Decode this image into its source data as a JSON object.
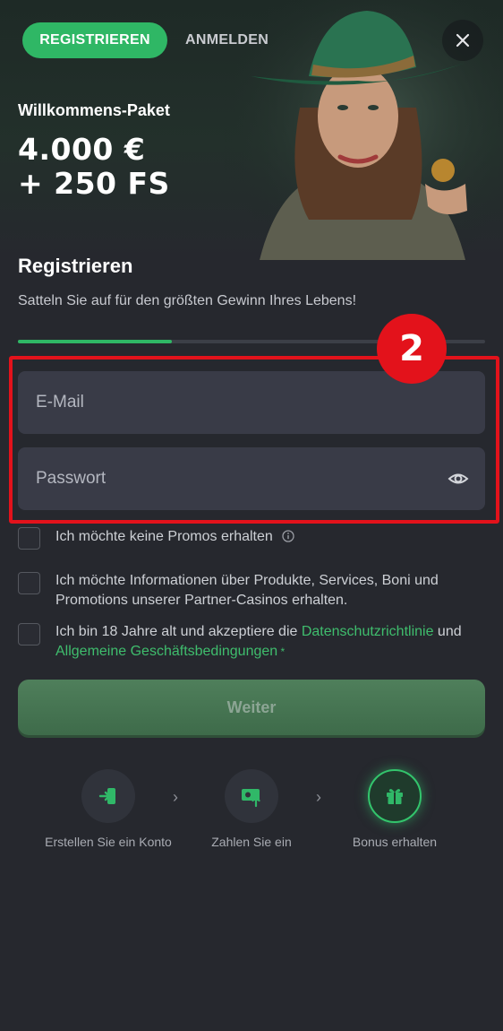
{
  "header": {
    "tab_register": "REGISTRIEREN",
    "tab_login": "ANMELDEN"
  },
  "promo": {
    "label": "Willkommens-Paket",
    "amount_line1": "4.000 €",
    "amount_line2": "+ 250 FS"
  },
  "form": {
    "title": "Registrieren",
    "subtitle": "Satteln Sie auf für den größten Gewinn Ihres Lebens!",
    "progress": 0.33,
    "email_placeholder": "E-Mail",
    "password_placeholder": "Passwort",
    "step_marker": "2",
    "checkboxes": [
      {
        "text": "Ich möchte keine Promos erhalten"
      },
      {
        "text": "Ich möchte Informationen über Produkte, Services, Boni und Promotions unserer Partner-Casinos erhalten."
      },
      {
        "text_before": "Ich bin 18 Jahre alt und akzeptiere die ",
        "link1": "Datenschutzrichtlinie",
        "text_mid": " und ",
        "link2": "Allgemeine Geschäftsbedingungen",
        "required_mark": " *"
      }
    ],
    "submit_label": "Weiter"
  },
  "steps": [
    {
      "label": "Erstellen Sie ein Konto",
      "icon": "login-icon"
    },
    {
      "label": "Zahlen Sie ein",
      "icon": "deposit-icon"
    },
    {
      "label": "Bonus erhalten",
      "icon": "gift-icon",
      "active": true
    }
  ],
  "colors": {
    "accent": "#2fb765",
    "highlight": "#e3121b",
    "background": "#26282e",
    "field": "#393b47"
  }
}
